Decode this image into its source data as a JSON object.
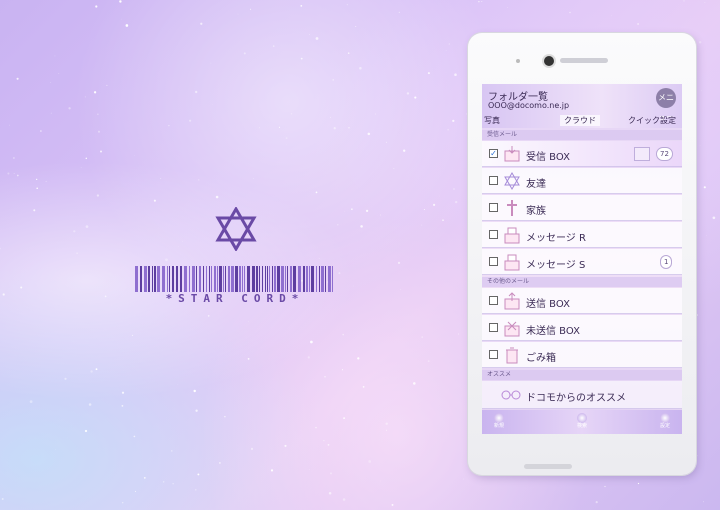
{
  "logo": {
    "wordmark": "*STAR CORD*"
  },
  "mail": {
    "header": {
      "title": "フォルダ一覧",
      "account": "OOO@docomo.ne.jp",
      "icon_label": "メニュー"
    },
    "tabs": [
      {
        "label": "写真",
        "active": false
      },
      {
        "label": "クラウド",
        "active": true
      },
      {
        "label": "クイック設定",
        "active": false
      }
    ],
    "section_inbox": "受信メール",
    "inbox_folders": [
      {
        "label": "受信 BOX",
        "checked": true,
        "icon": "inbox-icon",
        "count": "72"
      },
      {
        "label": "友達",
        "checked": false,
        "icon": "star-of-david-icon",
        "count": ""
      },
      {
        "label": "家族",
        "checked": false,
        "icon": "cross-icon",
        "count": ""
      },
      {
        "label": "メッセージ R",
        "checked": false,
        "icon": "message-r-icon",
        "count": ""
      },
      {
        "label": "メッセージ S",
        "checked": false,
        "icon": "message-s-icon",
        "count": "1"
      }
    ],
    "section_other": "その他のメール",
    "other_folders": [
      {
        "label": "送信 BOX",
        "checked": false,
        "icon": "outbox-icon"
      },
      {
        "label": "未送信 BOX",
        "checked": false,
        "icon": "draft-icon"
      },
      {
        "label": "ごみ箱",
        "checked": false,
        "icon": "trash-icon"
      }
    ],
    "section_recommend": "オススメ",
    "recommend": {
      "label": "ドコモからのオススメ",
      "icon": "glasses-icon"
    },
    "footer": [
      {
        "label": "新規",
        "icon": "new-mail-icon"
      },
      {
        "label": "検索",
        "icon": "search-icon"
      },
      {
        "label": "設定",
        "icon": "gear-icon"
      }
    ]
  },
  "colors": {
    "accent": "#6a4aa6",
    "check": "#2b6fd6"
  }
}
